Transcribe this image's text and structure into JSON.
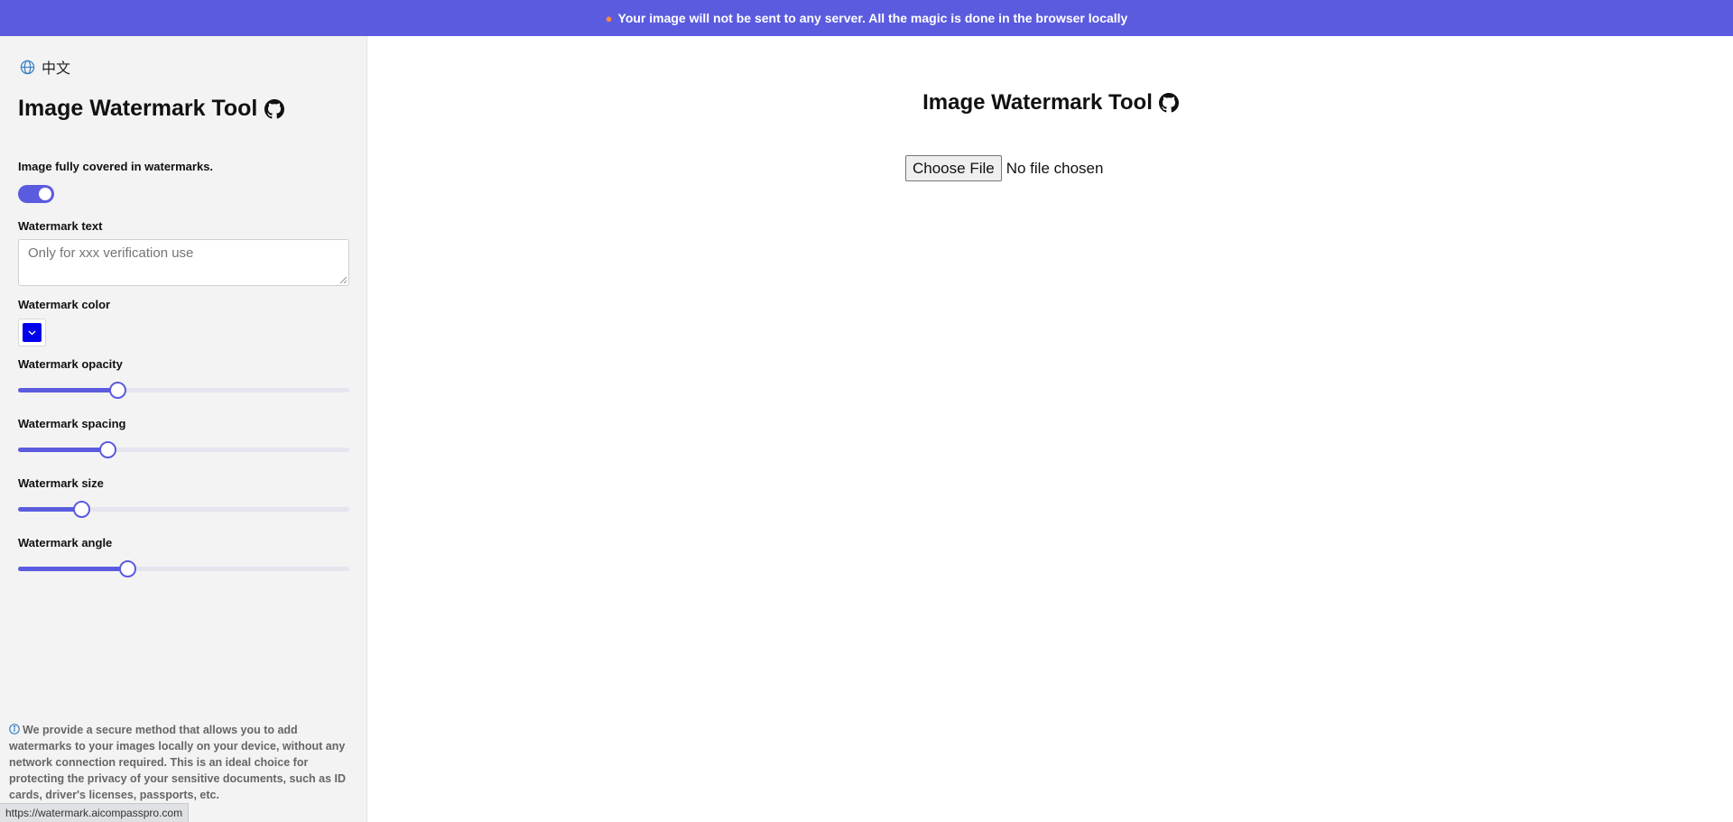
{
  "banner": {
    "icon": "flame-icon",
    "text": "Your image will not be sent to any server. All the magic is done in the browser locally"
  },
  "sidebar": {
    "language": "中文",
    "title": "Image Watermark Tool",
    "fully_covered_label": "Image fully covered in watermarks.",
    "fully_covered": true,
    "text_label": "Watermark text",
    "text_placeholder": "Only for xxx verification use",
    "color_label": "Watermark color",
    "color_value": "#0000ee",
    "opacity_label": "Watermark opacity",
    "opacity_fraction": 0.3,
    "spacing_label": "Watermark spacing",
    "spacing_fraction": 0.27,
    "size_label": "Watermark size",
    "size_fraction": 0.19,
    "angle_label": "Watermark angle",
    "angle_fraction": 0.33,
    "info": "We provide a secure method that allows you to add watermarks to your images locally on your device, without any network connection required. This is an ideal choice for protecting the privacy of your sensitive documents, such as ID cards, driver's licenses, passports, etc."
  },
  "main": {
    "title": "Image Watermark Tool",
    "choose_file_label": "Choose File",
    "file_status": "No file chosen"
  },
  "status_bar": {
    "url": "https://watermark.aicompasspro.com"
  },
  "colors": {
    "accent": "#5b5bdf",
    "sidebar_bg": "#f3f3f3"
  }
}
